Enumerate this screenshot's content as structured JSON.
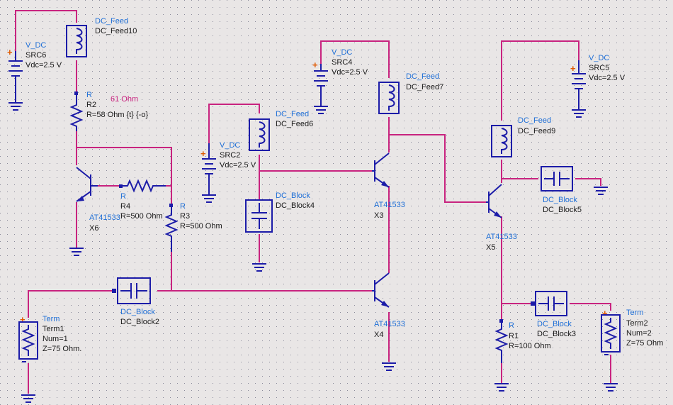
{
  "components": {
    "src6": {
      "type": "V_DC",
      "name": "SRC6",
      "param": "Vdc=2.5 V"
    },
    "src4": {
      "type": "V_DC",
      "name": "SRC4",
      "param": "Vdc=2.5 V"
    },
    "src5": {
      "type": "V_DC",
      "name": "SRC5",
      "param": "Vdc=2.5 V"
    },
    "src2": {
      "type": "V_DC",
      "name": "SRC2",
      "param": "Vdc=2.5 V"
    },
    "feed10": {
      "type": "DC_Feed",
      "name": "DC_Feed10"
    },
    "feed7": {
      "type": "DC_Feed",
      "name": "DC_Feed7"
    },
    "feed6": {
      "type": "DC_Feed",
      "name": "DC_Feed6"
    },
    "feed9": {
      "type": "DC_Feed",
      "name": "DC_Feed9"
    },
    "r2": {
      "type": "R",
      "name": "R2",
      "param": "R=58 Ohm {t} {-o}",
      "note": "61 Ohm"
    },
    "r4": {
      "type": "R",
      "name": "R4",
      "param": "R=500 Ohm"
    },
    "r3": {
      "type": "R",
      "name": "R3",
      "param": "R=500 Ohm"
    },
    "r1": {
      "type": "R",
      "name": "R1",
      "param": "R=100 Ohm"
    },
    "x6": {
      "type": "AT41533",
      "name": "X6"
    },
    "x3": {
      "type": "AT41533",
      "name": "X3"
    },
    "x4": {
      "type": "AT41533",
      "name": "X4"
    },
    "x5": {
      "type": "AT41533",
      "name": "X5"
    },
    "block4": {
      "type": "DC_Block",
      "name": "DC_Block4"
    },
    "block2": {
      "type": "DC_Block",
      "name": "DC_Block2"
    },
    "block5": {
      "type": "DC_Block",
      "name": "DC_Block5"
    },
    "block3": {
      "type": "DC_Block",
      "name": "DC_Block3"
    },
    "term1": {
      "type": "Term",
      "name": "Term1",
      "num": "Num=1",
      "z": "Z=75 Ohm."
    },
    "term2": {
      "type": "Term",
      "name": "Term2",
      "num": "Num=2",
      "z": "Z=75 Ohm"
    }
  },
  "colors": {
    "wire": "#c8237f",
    "component": "#1c1ca8",
    "label": "#1f6fd6",
    "background": "#e9e6e6"
  }
}
